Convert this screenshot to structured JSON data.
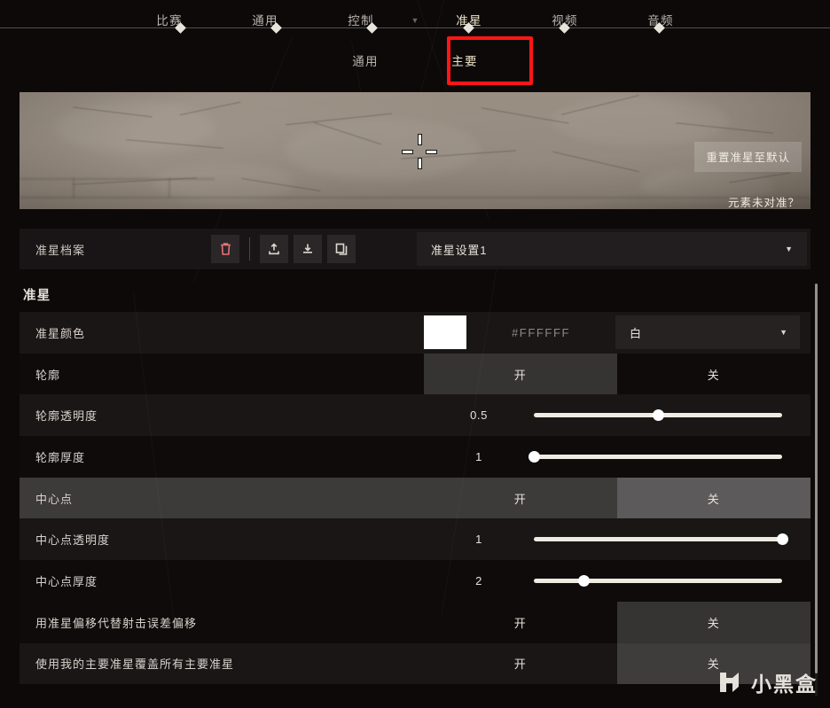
{
  "main_nav": {
    "tabs": [
      {
        "label": "比赛",
        "active": false
      },
      {
        "label": "通用",
        "active": false
      },
      {
        "label": "控制",
        "active": false
      },
      {
        "label": "准星",
        "active": true
      },
      {
        "label": "视频",
        "active": false
      },
      {
        "label": "音频",
        "active": false
      }
    ],
    "caret_icon": "chevron-down-icon"
  },
  "sub_nav": {
    "tabs": [
      {
        "label": "通用",
        "active": false
      },
      {
        "label": "主要",
        "active": true
      }
    ],
    "annotation_color": "#ff1616"
  },
  "preview": {
    "reset_button": "重置准星至默认",
    "misaligned_link": "元素未对准？",
    "crosshair_color": "#FFFFFF"
  },
  "profile": {
    "label": "准星档案",
    "actions": [
      {
        "name": "delete-profile-button",
        "icon": "trash-icon",
        "color": "#e8707a"
      },
      {
        "name": "import-profile-button",
        "icon": "upload-icon",
        "color": "#ddd7d0"
      },
      {
        "name": "export-profile-button",
        "icon": "download-icon",
        "color": "#ddd7d0"
      },
      {
        "name": "duplicate-profile-button",
        "icon": "copy-icon",
        "color": "#ddd7d0"
      }
    ],
    "selected": "准星设置1",
    "caret_icon": "chevron-down-icon"
  },
  "section": {
    "title": "准星"
  },
  "toggle_labels": {
    "on": "开",
    "off": "关"
  },
  "rows": [
    {
      "id": "crosshair-color",
      "label": "准星颜色",
      "type": "color",
      "swatch": "#FFFFFF",
      "hex": "#FFFFFF",
      "preset": "白",
      "band": "alt"
    },
    {
      "id": "outlines",
      "label": "轮廓",
      "type": "toggle",
      "value": "on",
      "band": "base"
    },
    {
      "id": "outline-opacity",
      "label": "轮廓透明度",
      "type": "slider",
      "value": "0.5",
      "percent": 50,
      "band": "alt"
    },
    {
      "id": "outline-thickness",
      "label": "轮廓厚度",
      "type": "slider",
      "value": "1",
      "percent": 0,
      "band": "base"
    },
    {
      "id": "center-dot",
      "label": "中心点",
      "type": "toggle",
      "value": "off",
      "band": "hl"
    },
    {
      "id": "center-dot-opacity",
      "label": "中心点透明度",
      "type": "slider",
      "value": "1",
      "percent": 100,
      "band": "alt"
    },
    {
      "id": "center-dot-thickness",
      "label": "中心点厚度",
      "type": "slider",
      "value": "2",
      "percent": 20,
      "band": "base"
    },
    {
      "id": "override-firing-error-offset",
      "label": "用准星偏移代替射击误差偏移",
      "type": "toggle",
      "value": "off",
      "band": "base"
    },
    {
      "id": "override-all-primary-crosshairs",
      "label": "使用我的主要准星覆盖所有主要准星",
      "type": "toggle",
      "value": "off",
      "band": "alt"
    }
  ],
  "watermark": {
    "text": "小黑盒"
  }
}
